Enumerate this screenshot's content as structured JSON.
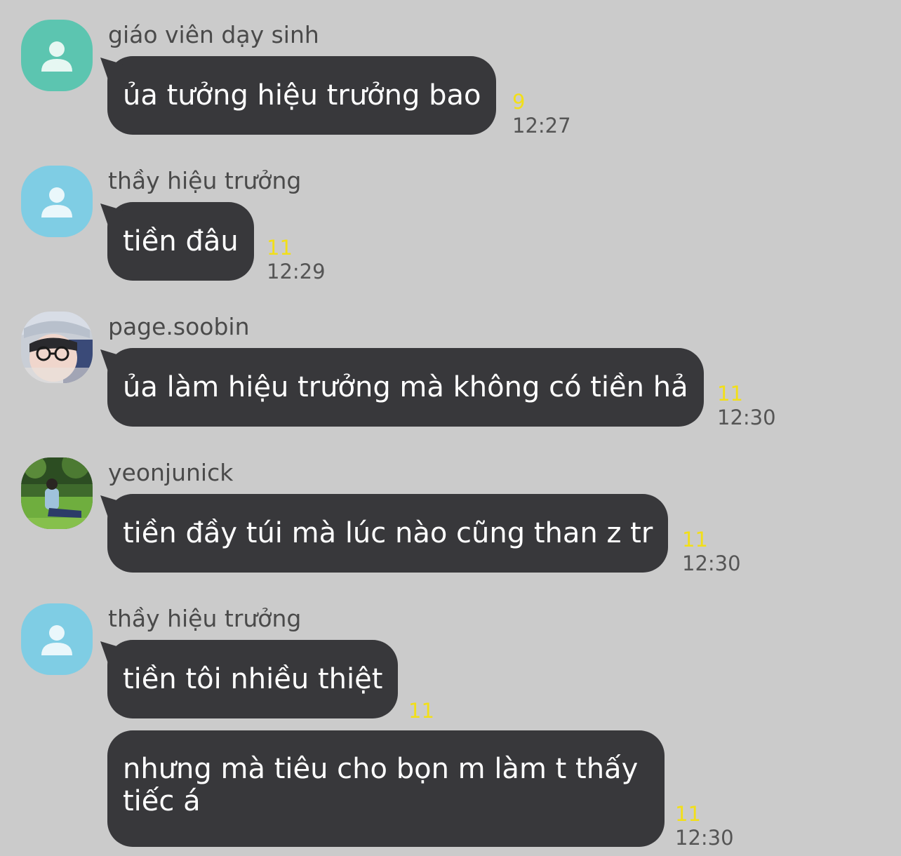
{
  "messages": [
    {
      "sender": "giáo viên dạy sinh",
      "avatar": "default-avatar-teal",
      "avatar_color": "#5cc5b0",
      "text": "ủa tưởng hiệu trưởng bao",
      "unread": "9",
      "time": "12:27"
    },
    {
      "sender": "thầy hiệu trưởng",
      "avatar": "default-avatar-blue",
      "avatar_color": "#7fcde4",
      "text": "tiền đâu",
      "unread": "11",
      "time": "12:29"
    },
    {
      "sender": "page.soobin",
      "avatar": "photo-avatar-boy-glasses",
      "text": "ủa làm hiệu trưởng mà không có tiền hả",
      "unread": "11",
      "time": "12:30"
    },
    {
      "sender": "yeonjunick",
      "avatar": "photo-avatar-grass",
      "text": "tiền đầy túi mà lúc nào cũng than z tr",
      "unread": "11",
      "time": "12:30"
    },
    {
      "sender": "thầy hiệu trưởng",
      "avatar": "default-avatar-blue",
      "avatar_color": "#7fcde4",
      "text": "tiền tôi nhiều thiệt",
      "unread": "11",
      "time": ""
    },
    {
      "sender": "",
      "text": "nhưng mà tiêu cho bọn m làm t thấy tiếc á",
      "unread": "11",
      "time": "12:30"
    }
  ],
  "colors": {
    "background": "#cbcbcb",
    "bubble": "#38383b",
    "unread": "#f2df18",
    "time": "#555555"
  }
}
